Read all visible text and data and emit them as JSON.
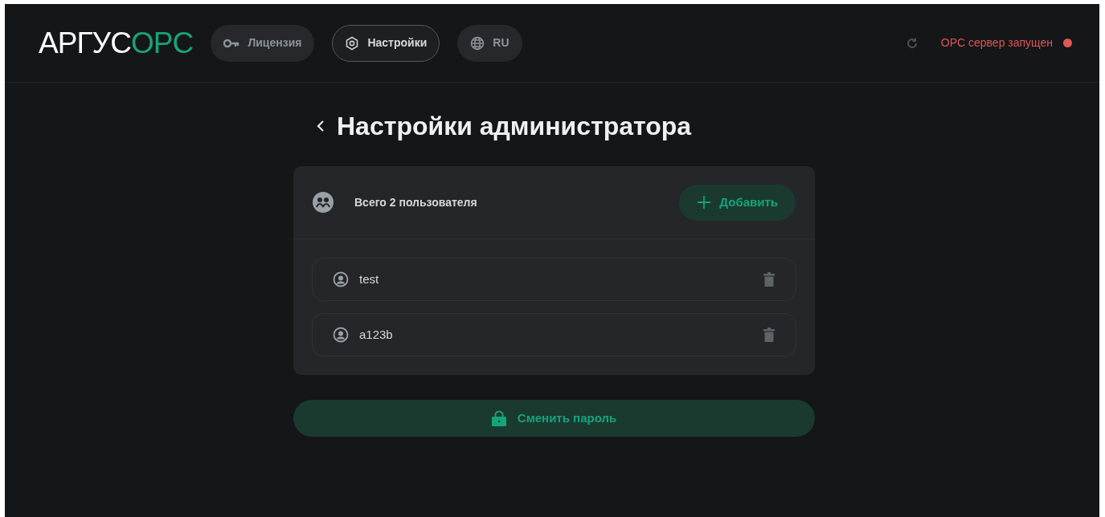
{
  "logo": {
    "part_1": "АРГУС",
    "part_2": "OPC"
  },
  "nav": [
    {
      "kind": "key",
      "label": "Лицензия",
      "selected": false
    },
    {
      "kind": "gear",
      "label": "Настройки",
      "selected": true
    },
    {
      "kind": "globe",
      "label": "RU",
      "selected": false
    }
  ],
  "server_status": {
    "text": "OPC сервер запущен",
    "color": "#e05555"
  },
  "page_title": "Настройки администратора",
  "users_panel": {
    "summary": "Всего 2 пользователя",
    "add_button": "Добавить",
    "users": [
      {
        "name": "test"
      },
      {
        "name": "a123b"
      }
    ]
  },
  "change_password_button": "Сменить пароль"
}
